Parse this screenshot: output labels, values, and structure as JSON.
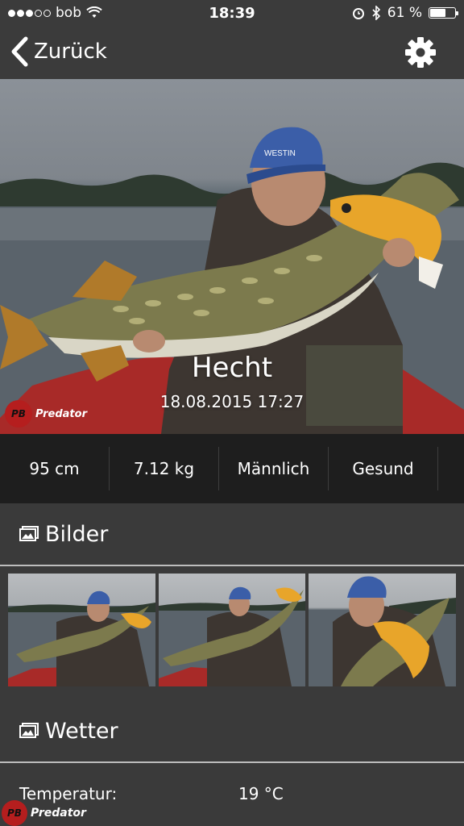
{
  "status_bar": {
    "carrier": "bob",
    "time": "18:39",
    "battery": "61 %",
    "signal_bars_filled": 3,
    "signal_bars_total": 5,
    "battery_level": 0.61
  },
  "nav": {
    "back_label": "Zurück",
    "settings_icon": "gear-icon"
  },
  "catch": {
    "species": "Hecht",
    "datetime": "18.08.2015 17:27",
    "hero_watermark": "Predator"
  },
  "stats": [
    {
      "value": "95 cm"
    },
    {
      "value": "7.12 kg"
    },
    {
      "value": "Männlich"
    },
    {
      "value": "Gesund"
    }
  ],
  "images_section": {
    "title": "Bilder",
    "icon": "images-icon",
    "thumb_count": 3
  },
  "weather_section": {
    "title": "Wetter",
    "icon": "images-icon",
    "temperature_label": "Temperatur:",
    "temperature_value": "19 °C"
  },
  "colors": {
    "background": "#3a3a3a",
    "stats_bar": "#1e1e1e",
    "watermark_red": "#b51e1e"
  }
}
